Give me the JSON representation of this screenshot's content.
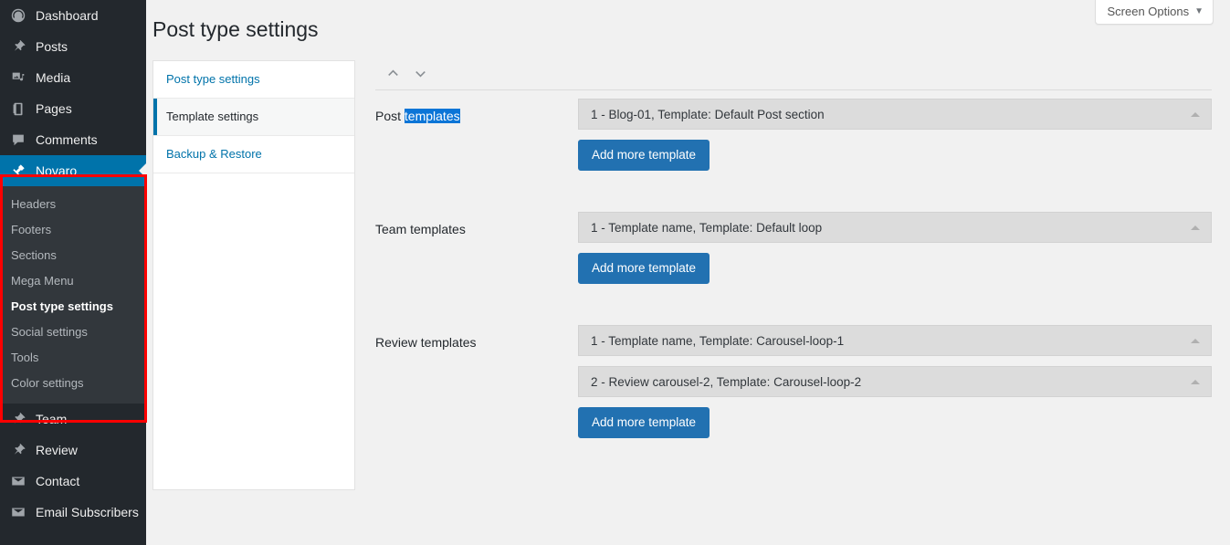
{
  "sidebar": {
    "items": [
      {
        "label": "Dashboard",
        "icon": "dashboard-icon"
      },
      {
        "label": "Posts",
        "icon": "pin-icon"
      },
      {
        "label": "Media",
        "icon": "media-icon"
      },
      {
        "label": "Pages",
        "icon": "pages-icon"
      },
      {
        "label": "Comments",
        "icon": "comments-icon"
      },
      {
        "label": "Novaro",
        "icon": "hammer-icon",
        "current": true
      }
    ],
    "submenu": [
      {
        "label": "Headers"
      },
      {
        "label": "Footers"
      },
      {
        "label": "Sections"
      },
      {
        "label": "Mega Menu"
      },
      {
        "label": "Post type settings",
        "current": true
      },
      {
        "label": "Social settings"
      },
      {
        "label": "Tools"
      },
      {
        "label": "Color settings"
      }
    ],
    "items_after": [
      {
        "label": "Team",
        "icon": "pin-icon"
      },
      {
        "label": "Review",
        "icon": "pin-icon"
      },
      {
        "label": "Contact",
        "icon": "envelope-icon"
      },
      {
        "label": "Email Subscribers",
        "icon": "envelope-icon"
      }
    ],
    "highlight_color": "#ff0000",
    "current_color": "#0073aa"
  },
  "header": {
    "screen_options": "Screen Options",
    "screen_options_caret": "▼",
    "page_title": "Post type settings"
  },
  "tabs": [
    {
      "label": "Post type settings",
      "active": false
    },
    {
      "label": "Template settings",
      "active": true
    },
    {
      "label": "Backup & Restore",
      "active": false
    }
  ],
  "content": {
    "sort_up_icon": "chevron-up-icon",
    "sort_down_icon": "chevron-down-icon",
    "add_button_label": "Add more template",
    "groups": [
      {
        "label_prefix": "Post ",
        "label_selected": "templates",
        "label_full": "Post templates",
        "rows": [
          {
            "text": "1 - Blog-01, Template: Default Post section"
          }
        ]
      },
      {
        "label_prefix": "Team templates",
        "label_selected": "",
        "label_full": "Team templates",
        "rows": [
          {
            "text": "1 - Template name, Template: Default loop"
          }
        ]
      },
      {
        "label_prefix": "Review templates",
        "label_selected": "",
        "label_full": "Review templates",
        "rows": [
          {
            "text": "1 - Template name, Template: Carousel-loop-1"
          },
          {
            "text": "2 - Review carousel-2, Template: Carousel-loop-2"
          }
        ]
      }
    ]
  }
}
